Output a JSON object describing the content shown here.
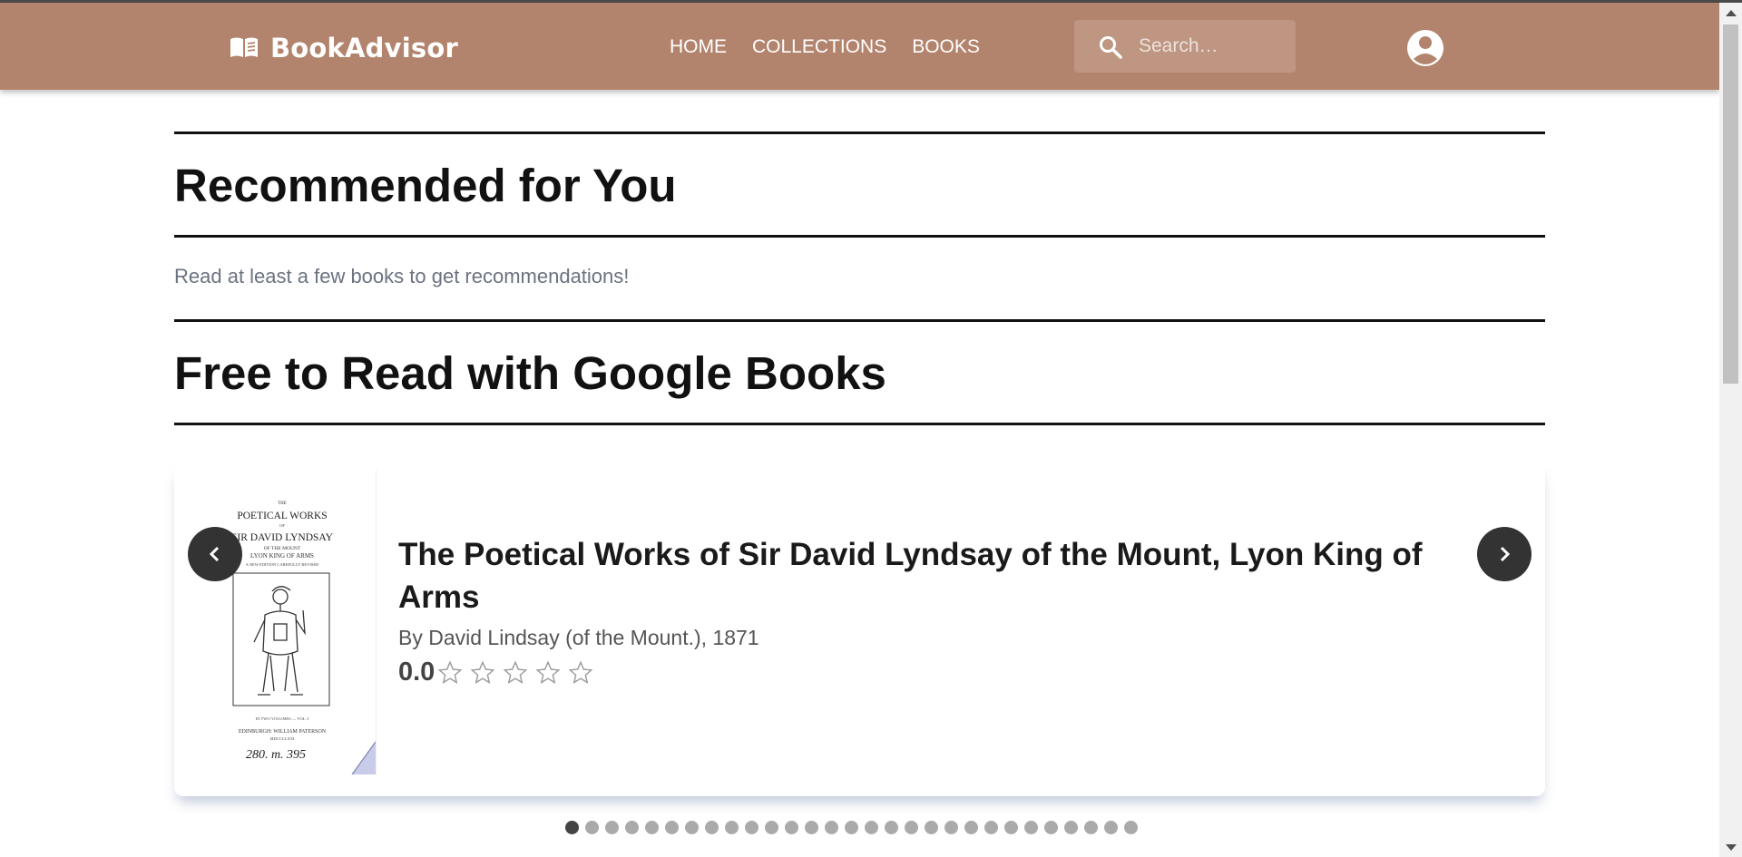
{
  "brand": {
    "name": "BookAdvisor",
    "logo_icon": "open-book-icon"
  },
  "nav": {
    "links": [
      "HOME",
      "COLLECTIONS",
      "BOOKS"
    ]
  },
  "search": {
    "placeholder": "Search…",
    "value": "",
    "icon": "search-icon"
  },
  "account": {
    "icon": "account-circle-icon"
  },
  "sections": {
    "recommended": {
      "title": "Recommended for You",
      "message": "Read at least a few books to get recommendations!"
    },
    "free": {
      "title": "Free to Read with Google Books"
    }
  },
  "carousel": {
    "book": {
      "title": "The Poetical Works of Sir David Lyndsay of the Mount, Lyon King of Arms",
      "author_line": "By David Lindsay (of the Mount.), 1871",
      "rating": "0.0",
      "stars_filled": 0,
      "stars_total": 5,
      "cover": {
        "line1": "THE",
        "line2": "POETICAL WORKS",
        "line3": "OF",
        "line4": "SIR DAVID LYNDSAY",
        "line5": "OF THE MOUNT",
        "line6": "LYON KING OF ARMS",
        "line7": "A NEW EDITION CAREFULLY REVISED",
        "line8": "IN TWO VOLUMES — VOL. I",
        "line9": "EDINBURGH: WILLIAM PATERSON",
        "line10": "MDCCCLXXI",
        "handwritten": "280. m. 395"
      }
    },
    "prev_icon": "chevron-left-icon",
    "next_icon": "chevron-right-icon",
    "page_count": 29,
    "active_page": 1
  },
  "colors": {
    "navbar": "#b3846d",
    "text": "#111111",
    "muted": "#6b7280",
    "button": "#333333"
  }
}
